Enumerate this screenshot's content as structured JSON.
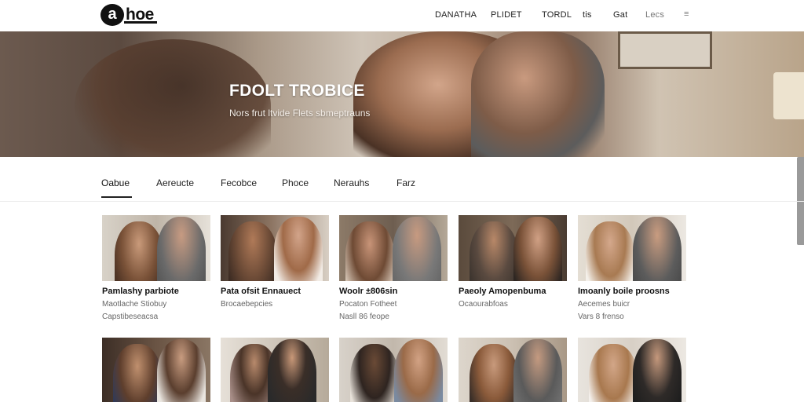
{
  "brand": {
    "mark": "a",
    "name": "hoe"
  },
  "nav": [
    "DANATHA",
    "PLIDET",
    "TORDL",
    "tis",
    "Gat",
    "Lecs",
    "≡"
  ],
  "hero": {
    "title": "FDOLT TROBICE",
    "subtitle": "Nors frut ltvide Flets sbmeptrauns"
  },
  "tabs": [
    "Oabue",
    "Aereucte",
    "Fecobce",
    "Phoce",
    "Nerauhs",
    "Farz"
  ],
  "cards_row1": [
    {
      "title": "Pamlashy parbiote",
      "meta1": "Maotlache Stiobuy",
      "meta2": "Capstibeseacsa"
    },
    {
      "title": "Pata ofsit Ennauect",
      "meta1": "Brocaebepcies",
      "meta2": ""
    },
    {
      "title": "Woolr ±806sin",
      "meta1": "Pocaton Fotheet",
      "meta2": "Nasll 86 feope"
    },
    {
      "title": "Paeoly Amopenbuma",
      "meta1": "Ocaourabfoas",
      "meta2": ""
    },
    {
      "title": "Imoanly boile proosns",
      "meta1": "Aecemes buicr",
      "meta2": "Vars 8 frenso"
    }
  ],
  "cards_row2": [
    {
      "title": ""
    },
    {
      "title": ""
    },
    {
      "title": ""
    },
    {
      "title": ""
    },
    {
      "title": ""
    }
  ],
  "colors": {
    "accent": "#222222",
    "hero_text": "#ffffff",
    "muted": "#666666"
  }
}
